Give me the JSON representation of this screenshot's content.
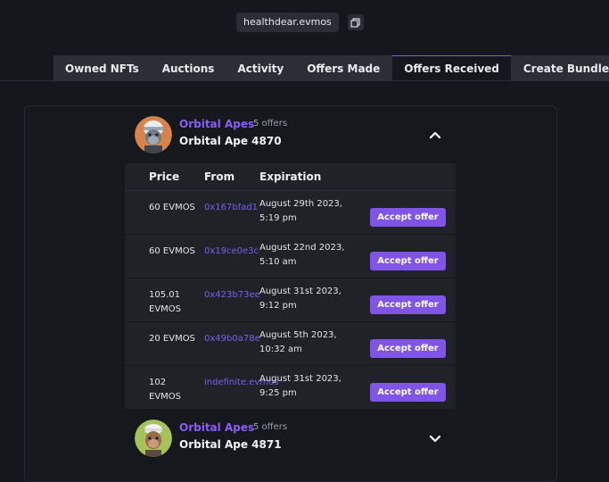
{
  "wallet": {
    "name": "healthdear.evmos"
  },
  "tabs": [
    {
      "label": "Owned NFTs",
      "active": false
    },
    {
      "label": "Auctions",
      "active": false
    },
    {
      "label": "Activity",
      "active": false
    },
    {
      "label": "Offers Made",
      "active": false
    },
    {
      "label": "Offers Received",
      "active": true
    },
    {
      "label": "Create Bundle",
      "active": false
    }
  ],
  "collections": [
    {
      "collection": "Orbital Apes",
      "offers": "5 offers",
      "item": "Orbital Ape 4870",
      "expanded": true,
      "columns": {
        "price": "Price",
        "from": "From",
        "expiration": "Expiration"
      },
      "rows": [
        {
          "price": "60 EVMOS",
          "from": "0x167bfad1",
          "expiration": "August 29th 2023, 5:19 pm",
          "action": "Accept offer"
        },
        {
          "price": "60 EVMOS",
          "from": "0x19ce0e3c",
          "expiration": "August 22nd 2023, 5:10 am",
          "action": "Accept offer"
        },
        {
          "price": "105.01 EVMOS",
          "from": "0x423b73ee",
          "expiration": "August 31st 2023, 9:12 pm",
          "action": "Accept offer"
        },
        {
          "price": "20 EVMOS",
          "from": "0x49b0a78e",
          "expiration": "August 5th 2023, 10:32 am",
          "action": "Accept offer"
        },
        {
          "price": "102 EVMOS",
          "from": "indefinite.evmos",
          "expiration": "August 31st 2023, 9:25 pm",
          "action": "Accept offer"
        }
      ]
    },
    {
      "collection": "Orbital Apes",
      "offers": "5 offers",
      "item": "Orbital Ape 4871",
      "expanded": false
    }
  ],
  "colors": {
    "accent": "#8b5cf6",
    "button": "#7f54e6",
    "background": "#14171b",
    "table": "#1f2327"
  }
}
